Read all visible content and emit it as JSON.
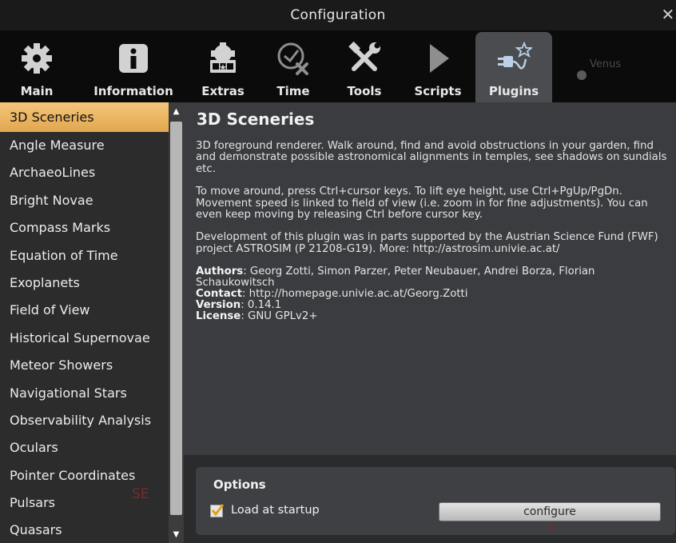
{
  "window": {
    "title": "Configuration",
    "close_glyph": "✕"
  },
  "tabs": [
    {
      "label": "Main",
      "icon": "gear-icon"
    },
    {
      "label": "Information",
      "icon": "info-icon"
    },
    {
      "label": "Extras",
      "icon": "extras-icon"
    },
    {
      "label": "Time",
      "icon": "clock-icon"
    },
    {
      "label": "Tools",
      "icon": "tools-icon"
    },
    {
      "label": "Scripts",
      "icon": "play-icon"
    },
    {
      "label": "Plugins",
      "icon": "plugin-icon",
      "active": true
    }
  ],
  "sidebar": {
    "items": [
      "3D Sceneries",
      "Angle Measure",
      "ArchaeoLines",
      "Bright Novae",
      "Compass Marks",
      "Equation of Time",
      "Exoplanets",
      "Field of View",
      "Historical Supernovae",
      "Meteor Showers",
      "Navigational Stars",
      "Observability Analysis",
      "Oculars",
      "Pointer Coordinates",
      "Pulsars",
      "Quasars"
    ],
    "selected": "3D Sceneries"
  },
  "plugin": {
    "title": "3D Sceneries",
    "para1": "3D foreground renderer. Walk around, find and avoid obstructions in your garden, find and demonstrate possible astronomical alignments in temples, see shadows on sundials etc.",
    "para2": "To move around, press Ctrl+cursor keys. To lift eye height, use Ctrl+PgUp/PgDn. Movement speed is linked to field of view (i.e. zoom in for fine adjustments). You can even keep moving by releasing Ctrl before cursor key.",
    "para3": "Development of this plugin was in parts supported by the Austrian Science Fund (FWF) project ASTROSIM (P 21208-G19). More: http://astrosim.univie.ac.at/",
    "authors_label": "Authors",
    "authors": ": Georg Zotti, Simon Parzer, Peter Neubauer, Andrei Borza, Florian Schaukowitsch",
    "contact_label": "Contact",
    "contact": ": http://homepage.univie.ac.at/Georg.Zotti",
    "version_label": "Version",
    "version": ": 0.14.1",
    "license_label": "License",
    "license": ": GNU GPLv2+"
  },
  "options": {
    "heading": "Options",
    "load_at_startup_label": "Load at startup",
    "load_at_startup": true,
    "configure_label": "configure"
  },
  "background": {
    "planet_label": "Venus",
    "compass_se": "SE",
    "compass_s": "S"
  },
  "colors": {
    "selected_item": "#f0b862",
    "active_tab": "#4a4c50",
    "panel": "#3b3c3f"
  }
}
